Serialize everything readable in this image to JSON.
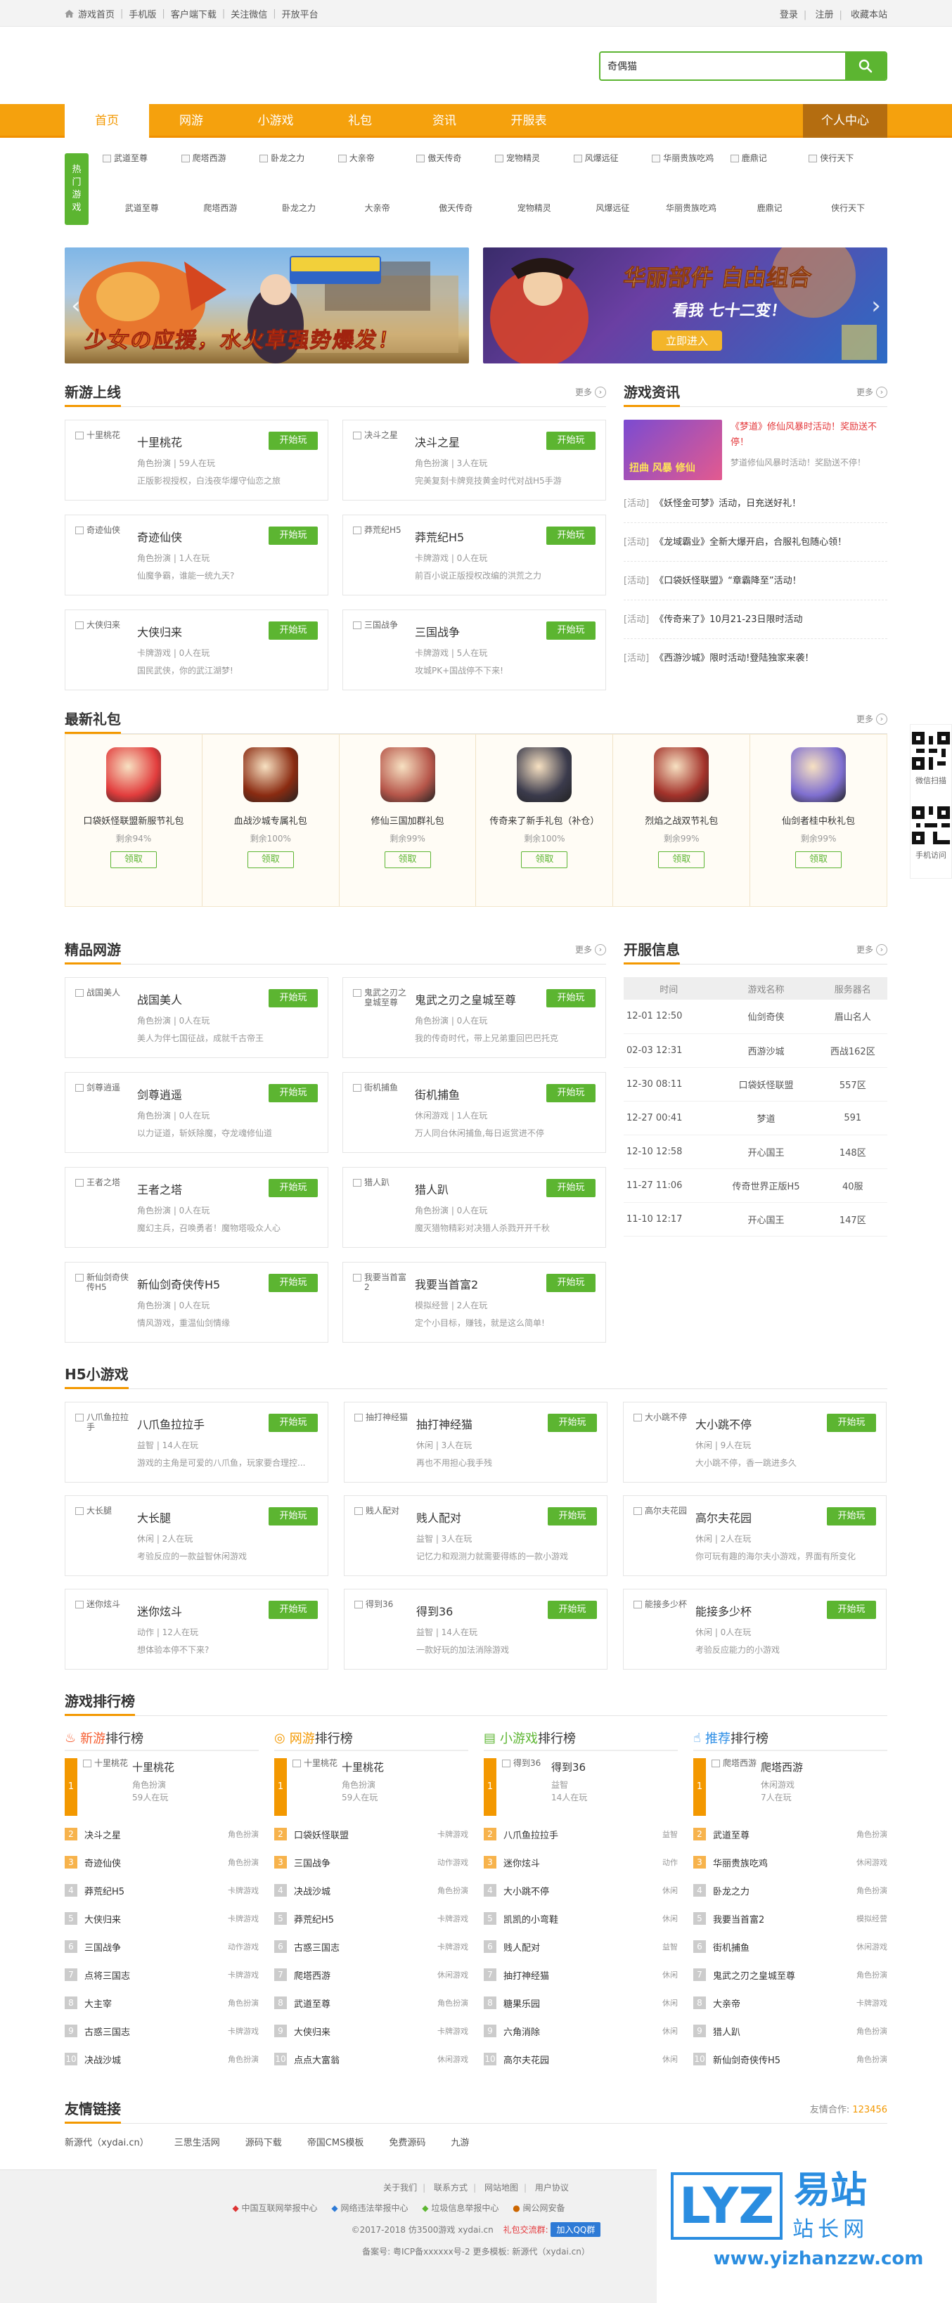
{
  "topbar": {
    "left": [
      "游戏首页",
      "手机版",
      "客户端下载",
      "关注微信",
      "开放平台"
    ],
    "right": [
      "登录",
      "注册",
      "收藏本站"
    ]
  },
  "search": {
    "value": "奇偶猫"
  },
  "nav": {
    "items": [
      "首页",
      "网游",
      "小游戏",
      "礼包",
      "资讯",
      "开服表"
    ],
    "personal": "个人中心"
  },
  "hot": {
    "label": "热门游戏",
    "top": [
      "武道至尊",
      "爬塔西游",
      "卧龙之力",
      "大亲帝",
      "傲天传奇",
      "宠物精灵",
      "风爆远征",
      "华丽贵族吃鸡",
      "鹿鼎记",
      "侠行天下"
    ],
    "bottom": [
      "武道至尊",
      "爬塔西游",
      "卧龙之力",
      "大亲帝",
      "傲天传奇",
      "宠物精灵",
      "风爆远征",
      "华丽贵族吃鸡",
      "鹿鼎记",
      "侠行天下"
    ]
  },
  "banners": [
    {
      "caption": "少女の应援，水火草强势爆发！"
    },
    {
      "title": "华丽部件 自由组合",
      "sub": "看我 七十二变！",
      "btn": "立即进入"
    }
  ],
  "sections": {
    "new_games": "新游上线",
    "news": "游戏资讯",
    "gifts": "最新礼包",
    "premium": "精品网游",
    "servers": "开服信息",
    "h5": "H5小游戏",
    "rank": "游戏排行榜",
    "links": "友情链接",
    "more": "更多"
  },
  "play_label": "开始玩",
  "new_games": [
    {
      "thumb": "十里桃花",
      "name": "十里桃花",
      "meta": "角色扮演 | 59人在玩",
      "desc": "正版影视授权，白浅夜华爆守仙恋之旅"
    },
    {
      "thumb": "决斗之星",
      "name": "决斗之星",
      "meta": "角色扮演 | 3人在玩",
      "desc": "完美复刻卡牌竞技黄金时代对战H5手游"
    },
    {
      "thumb": "奇迹仙侠",
      "name": "奇迹仙侠",
      "meta": "角色扮演 | 1人在玩",
      "desc": "仙魔争霸，谁能一统九天?"
    },
    {
      "thumb": "莽荒纪H5",
      "name": "莽荒纪H5",
      "meta": "卡牌游戏 | 0人在玩",
      "desc": "前百小说正版授权改编的洪荒之力"
    },
    {
      "thumb": "大侠归来",
      "name": "大侠归来",
      "meta": "卡牌游戏 | 0人在玩",
      "desc": "国民武侠，你的武江湖梦!"
    },
    {
      "thumb": "三国战争",
      "name": "三国战争",
      "meta": "卡牌游戏 | 5人在玩",
      "desc": "攻城PK+国战停不下来!"
    }
  ],
  "news": {
    "top": {
      "title": "《梦道》修仙风暴时活动！奖励送不停！",
      "desc": "梦道修仙风暴时活动！奖励送不停！",
      "img_title": "扭曲 风暴 修仙"
    },
    "items": [
      {
        "k": "[活动]",
        "t": "《妖怪金可梦》活动，日充送好礼！"
      },
      {
        "k": "[活动]",
        "t": "《龙域霸业》全新大爆开启，合服礼包随心领！"
      },
      {
        "k": "[活动]",
        "t": "《口袋妖怪联盟》“章霸降至”活动！"
      },
      {
        "k": "[活动]",
        "t": "《传奇来了》10月21-23日限时活动"
      },
      {
        "k": "[活动]",
        "t": "《西游沙城》限时活动!登陆独家来袭！"
      }
    ]
  },
  "gifts": [
    {
      "name": "口袋妖怪联盟新服节礼包",
      "pct": "剩余94%",
      "btn": "领取",
      "icon": "#e23d3d"
    },
    {
      "name": "血战沙城专属礼包",
      "pct": "剩余100%",
      "btn": "领取",
      "icon": "#8a2b11"
    },
    {
      "name": "修仙三国加群礼包",
      "pct": "剩余99%",
      "btn": "领取",
      "icon": "#b6564a"
    },
    {
      "name": "传奇来了新手礼包（补仓）",
      "pct": "剩余100%",
      "btn": "领取",
      "icon": "#3b3b4c"
    },
    {
      "name": "烈焰之战双节礼包",
      "pct": "剩余99%",
      "btn": "领取",
      "icon": "#a3322a"
    },
    {
      "name": "仙剑者桂中秋礼包",
      "pct": "剩余99%",
      "btn": "领取",
      "icon": "#7f6fd0"
    }
  ],
  "premium": [
    {
      "thumb": "战国美人",
      "name": "战国美人",
      "meta": "角色扮演 | 0人在玩",
      "desc": "美人为伴七国征战，成就千古帝王"
    },
    {
      "thumb": "鬼武之刃之皇城至尊",
      "name": "鬼武之刃之皇城至尊",
      "meta": "角色扮演 | 0人在玩",
      "desc": "我的传奇时代，带上兄弟重回巴巴托克"
    },
    {
      "thumb": "剑尊逍遥",
      "name": "剑尊逍遥",
      "meta": "角色扮演 | 0人在玩",
      "desc": "以力证道，斩妖除魔，夺龙魂修仙道"
    },
    {
      "thumb": "街机捕鱼",
      "name": "街机捕鱼",
      "meta": "休闲游戏 | 1人在玩",
      "desc": "万人同台休闲捕鱼,每日返赏进不停"
    },
    {
      "thumb": "王者之塔",
      "name": "王者之塔",
      "meta": "角色扮演 | 0人在玩",
      "desc": "魔幻主兵，召唤勇者！魔物塔吸众人心"
    },
    {
      "thumb": "猎人趴",
      "name": "猎人趴",
      "meta": "角色扮演 | 0人在玩",
      "desc": "魔灭猎物精彩对决猎人杀戮开开千秋"
    },
    {
      "thumb": "新仙剑奇侠传H5",
      "name": "新仙剑奇侠传H5",
      "meta": "角色扮演 | 0人在玩",
      "desc": "情风游戏，重温仙剑情缘"
    },
    {
      "thumb": "我要当首富2",
      "name": "我要当首富2",
      "meta": "模拟经营 | 2人在玩",
      "desc": "定个小目标，赚钱，就是这么简单!"
    }
  ],
  "servers": {
    "head": [
      "时间",
      "游戏名称",
      "服务器名"
    ],
    "rows": [
      [
        "12-01 12:50",
        "仙剑奇侠",
        "眉山名人"
      ],
      [
        "02-03 12:31",
        "西游沙城",
        "西战162区"
      ],
      [
        "12-30 08:11",
        "口袋妖怪联盟",
        "557区"
      ],
      [
        "12-27 00:41",
        "梦道",
        "591"
      ],
      [
        "12-10 12:58",
        "开心国王",
        "148区"
      ],
      [
        "11-27 11:06",
        "传奇世界正版H5",
        "40服"
      ],
      [
        "11-10 12:17",
        "开心国王",
        "147区"
      ]
    ]
  },
  "h5": [
    {
      "thumb": "八爪鱼拉拉手",
      "name": "八爪鱼拉拉手",
      "meta": "益智 | 14人在玩",
      "desc": "游戏的主角是可爱的八爪鱼，玩家要合理控..."
    },
    {
      "thumb": "抽打神经猫",
      "name": "抽打神经猫",
      "meta": "休闲 | 3人在玩",
      "desc": "再也不用担心我手残"
    },
    {
      "thumb": "大小跳不停",
      "name": "大小跳不停",
      "meta": "休闲 | 9人在玩",
      "desc": "大小跳不停，香一跳进多久"
    },
    {
      "thumb": "大长腿",
      "name": "大长腿",
      "meta": "休闲 | 2人在玩",
      "desc": "考验反应的一款益智休闲游戏"
    },
    {
      "thumb": "贱人配对",
      "name": "贱人配对",
      "meta": "益智 | 3人在玩",
      "desc": "记忆力和观测力就需要得练的一款小游戏"
    },
    {
      "thumb": "高尔夫花园",
      "name": "高尔夫花园",
      "meta": "休闲 | 2人在玩",
      "desc": "你可玩有趣的海尔夫小游戏，界面有所变化"
    },
    {
      "thumb": "迷你炫斗",
      "name": "迷你炫斗",
      "meta": "动作 | 12人在玩",
      "desc": "想体验本停不下来?"
    },
    {
      "thumb": "得到36",
      "name": "得到36",
      "meta": "益智 | 14人在玩",
      "desc": "一款好玩的加法消除游戏"
    },
    {
      "thumb": "能接多少杯",
      "name": "能接多少杯",
      "meta": "休闲 | 0人在玩",
      "desc": "考验反应能力的小游戏"
    }
  ],
  "rank": [
    {
      "name": "新游",
      "suffix": "排行榜",
      "color": "#f55b2e",
      "first": {
        "thumb": "十里桃花",
        "name": "十里桃花",
        "cat": "角色扮演",
        "count": "59人在玩"
      },
      "list": [
        [
          "决斗之星",
          "角色扮演"
        ],
        [
          "奇迹仙侠",
          "角色扮演"
        ],
        [
          "莽荒纪H5",
          "卡牌游戏"
        ],
        [
          "大侠归来",
          "卡牌游戏"
        ],
        [
          "三国战争",
          "动作游戏"
        ],
        [
          "点将三国志",
          "卡牌游戏"
        ],
        [
          "大主宰",
          "角色扮演"
        ],
        [
          "古惑三国志",
          "卡牌游戏"
        ],
        [
          "决战沙城",
          "角色扮演"
        ]
      ]
    },
    {
      "name": "网游",
      "suffix": "排行榜",
      "color": "#f39800",
      "first": {
        "thumb": "十里桃花",
        "name": "十里桃花",
        "cat": "角色扮演",
        "count": "59人在玩"
      },
      "list": [
        [
          "口袋妖怪联盟",
          "卡牌游戏"
        ],
        [
          "三国战争",
          "动作游戏"
        ],
        [
          "决战沙城",
          "角色扮演"
        ],
        [
          "莽荒纪H5",
          "卡牌游戏"
        ],
        [
          "古惑三国志",
          "卡牌游戏"
        ],
        [
          "爬塔西游",
          "休闲游戏"
        ],
        [
          "武道至尊",
          "角色扮演"
        ],
        [
          "大侠归来",
          "卡牌游戏"
        ],
        [
          "点点大富翁",
          "休闲游戏"
        ]
      ]
    },
    {
      "name": "小游戏",
      "suffix": "排行榜",
      "color": "#5cb531",
      "first": {
        "thumb": "得到36",
        "name": "得到36",
        "cat": "益智",
        "count": "14人在玩"
      },
      "list": [
        [
          "八爪鱼拉拉手",
          "益智"
        ],
        [
          "迷你炫斗",
          "动作"
        ],
        [
          "大小跳不停",
          "休闲"
        ],
        [
          "凯凯的小弯鞋",
          "休闲"
        ],
        [
          "贱人配对",
          "益智"
        ],
        [
          "抽打神经猫",
          "休闲"
        ],
        [
          "糖果乐园",
          "休闲"
        ],
        [
          "六角消除",
          "休闲"
        ],
        [
          "高尔夫花园",
          "休闲"
        ]
      ]
    },
    {
      "name": "推荐",
      "suffix": "排行榜",
      "color": "#2d8ee6",
      "first": {
        "thumb": "爬塔西游",
        "name": "爬塔西游",
        "cat": "休闲游戏",
        "count": "7人在玩"
      },
      "list": [
        [
          "武道至尊",
          "角色扮演"
        ],
        [
          "华丽贵族吃鸡",
          "休闲游戏"
        ],
        [
          "卧龙之力",
          "角色扮演"
        ],
        [
          "我要当首富2",
          "模拟经营"
        ],
        [
          "街机捕鱼",
          "休闲游戏"
        ],
        [
          "鬼武之刃之皇城至尊",
          "角色扮演"
        ],
        [
          "大亲帝",
          "卡牌游戏"
        ],
        [
          "猎人趴",
          "角色扮演"
        ],
        [
          "新仙剑奇侠传H5",
          "角色扮演"
        ]
      ]
    }
  ],
  "friend": {
    "coop_label": "友情合作:",
    "coop_qq": "123456",
    "links": [
      "新源代（xydai.cn）",
      "三思生活网",
      "源码下载",
      "帝国CMS模板",
      "免费源码",
      "九游"
    ]
  },
  "footer": {
    "links": [
      "关于我们",
      "联系方式",
      "网站地图",
      "用户协议"
    ],
    "badges": [
      "中国互联网举报中心",
      "网络违法举报中心",
      "垃圾信息举报中心",
      "闽公网安备"
    ],
    "copy": "©2017-2018  仿3500游戏  xydai.cn",
    "group_label": "礼包交流群:",
    "qq_btn": "加入QQ群",
    "icp": "备案号: 粤ICP备xxxxxx号-2  更多模板:  新源代（xydai.cn）"
  },
  "side": {
    "wx": "微信扫描",
    "mobile": "手机访问"
  },
  "watermark": {
    "brand": "易站",
    "sub": "站长网",
    "url": "www.yizhanzzw.com"
  }
}
